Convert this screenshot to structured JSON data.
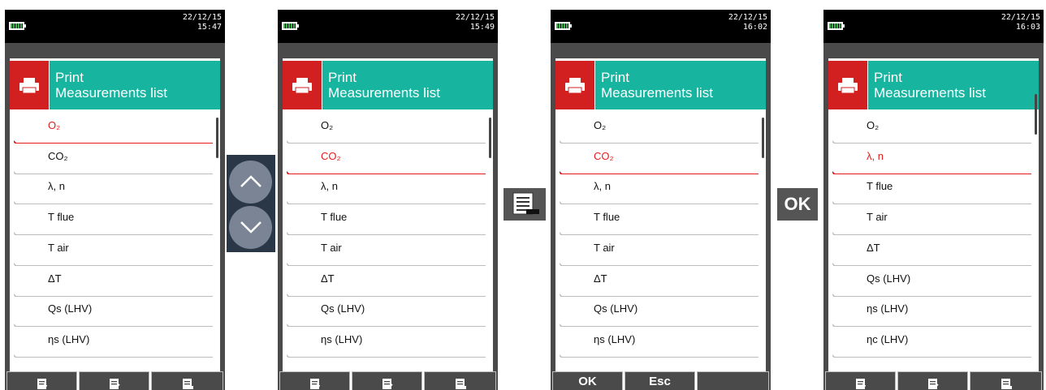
{
  "screens": [
    {
      "date": "22/12/15",
      "time": "15:47",
      "header": {
        "line1": "Print",
        "line2": "Measurements list"
      },
      "items": [
        {
          "label": "O₂",
          "selected": true
        },
        {
          "label": "CO₂",
          "selected": false
        },
        {
          "label": "λ, n",
          "selected": false
        },
        {
          "label": "T flue",
          "selected": false
        },
        {
          "label": "T air",
          "selected": false
        },
        {
          "label": "ΔT",
          "selected": false
        },
        {
          "label": "Qs (LHV)",
          "selected": false
        },
        {
          "label": "ηs (LHV)",
          "selected": false
        }
      ],
      "softkeys": [
        {
          "label": "",
          "icon": "doc-add-icon"
        },
        {
          "label": "",
          "icon": "doc-edit-icon"
        },
        {
          "label": "",
          "icon": "doc-print-icon"
        }
      ]
    },
    {
      "date": "22/12/15",
      "time": "15:49",
      "header": {
        "line1": "Print",
        "line2": "Measurements list"
      },
      "items": [
        {
          "label": "O₂",
          "selected": false
        },
        {
          "label": "CO₂",
          "selected": true
        },
        {
          "label": "λ, n",
          "selected": false
        },
        {
          "label": "T flue",
          "selected": false
        },
        {
          "label": "T air",
          "selected": false
        },
        {
          "label": "ΔT",
          "selected": false
        },
        {
          "label": "Qs (LHV)",
          "selected": false
        },
        {
          "label": "ηs (LHV)",
          "selected": false
        }
      ],
      "softkeys": [
        {
          "label": "",
          "icon": "doc-add-icon"
        },
        {
          "label": "",
          "icon": "doc-edit-icon"
        },
        {
          "label": "",
          "icon": "doc-print-icon"
        }
      ]
    },
    {
      "date": "22/12/15",
      "time": "16:02",
      "header": {
        "line1": "Print",
        "line2": "Measurements list"
      },
      "items": [
        {
          "label": "O₂",
          "selected": false
        },
        {
          "label": "CO₂",
          "selected": true
        },
        {
          "label": "λ, n",
          "selected": false
        },
        {
          "label": "T flue",
          "selected": false
        },
        {
          "label": "T air",
          "selected": false
        },
        {
          "label": "ΔT",
          "selected": false
        },
        {
          "label": "Qs (LHV)",
          "selected": false
        },
        {
          "label": "ηs (LHV)",
          "selected": false
        }
      ],
      "softkeys": [
        {
          "label": "OK",
          "icon": ""
        },
        {
          "label": "Esc",
          "icon": ""
        },
        {
          "label": "",
          "icon": ""
        }
      ]
    },
    {
      "date": "22/12/15",
      "time": "16:03",
      "header": {
        "line1": "Print",
        "line2": "Measurements list"
      },
      "items": [
        {
          "label": "O₂",
          "selected": false
        },
        {
          "label": "λ, n",
          "selected": true
        },
        {
          "label": "T flue",
          "selected": false
        },
        {
          "label": "T air",
          "selected": false
        },
        {
          "label": "ΔT",
          "selected": false
        },
        {
          "label": "Qs (LHV)",
          "selected": false
        },
        {
          "label": "ηs (LHV)",
          "selected": false
        },
        {
          "label": "ηc (LHV)",
          "selected": false
        }
      ],
      "softkeys": [
        {
          "label": "",
          "icon": "doc-add-icon"
        },
        {
          "label": "",
          "icon": "doc-edit-icon"
        },
        {
          "label": "",
          "icon": "doc-print-icon"
        }
      ]
    }
  ],
  "between_keys": {
    "nav_up_icon": "arrow-up-icon",
    "nav_down_icon": "arrow-down-icon",
    "menu_icon": "menu-list-icon",
    "ok_label": "OK"
  },
  "colors": {
    "header_teal": "#17b4a0",
    "header_red": "#d21f1f",
    "selected_red": "#e41c1c",
    "screen_gray": "#4a4a4a",
    "key_gray": "#555555"
  }
}
